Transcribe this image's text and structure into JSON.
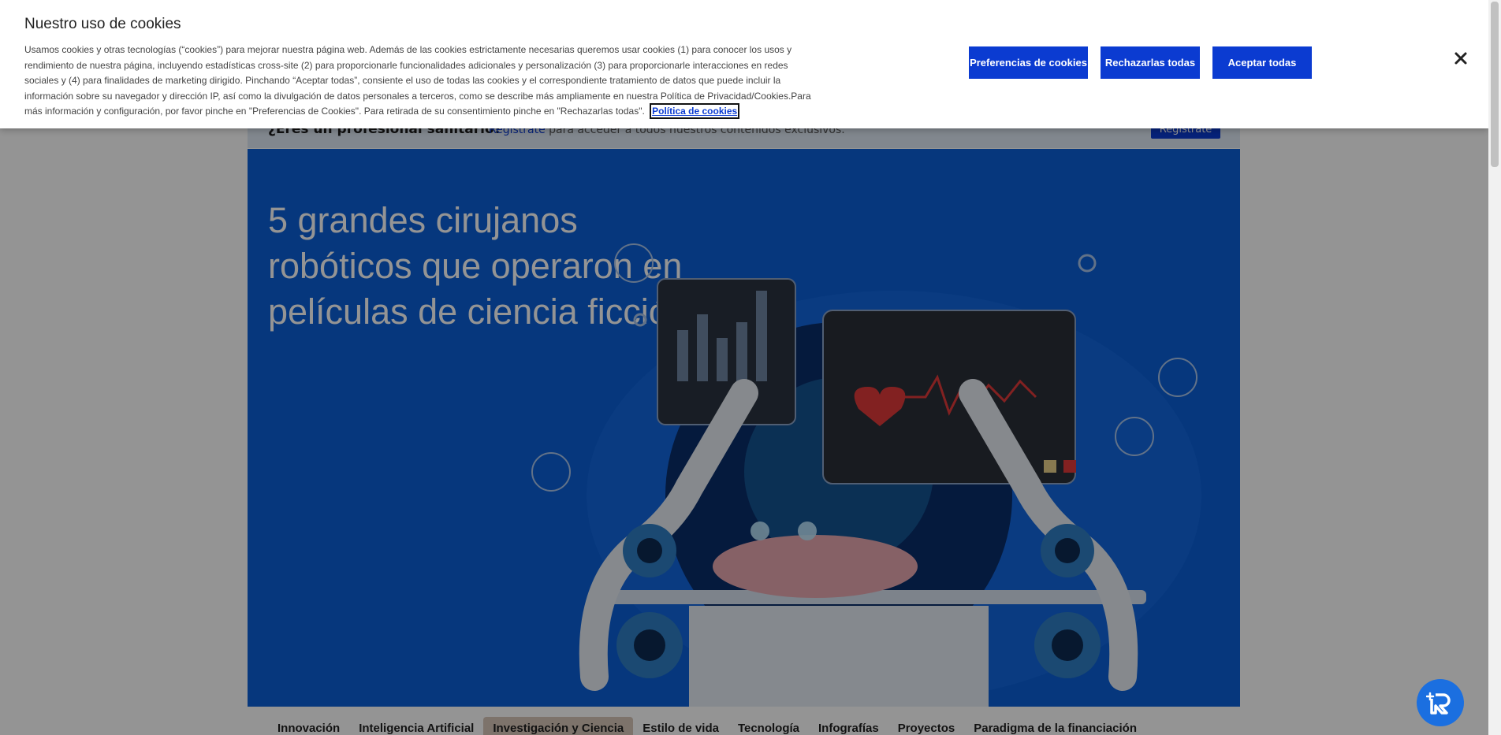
{
  "cookie_banner": {
    "title": "Nuestro uso de cookies",
    "body": "Usamos cookies y otras tecnologías (“cookies”) para mejorar nuestra página web. Además de las cookies estrictamente necesarias queremos usar cookies (1) para conocer los usos y rendimiento de nuestra página, incluyendo estadísticas cross-site (2) para proporcionarle funcionalidades adicionales y personalización (3) para proporcionarle interacciones en redes sociales y (4) para finalidades de marketing dirigido. Pinchando “Aceptar todas”, consiente el uso de todas las cookies y el correspondiente tratamiento de datos que puede incluir la información sobre su navegador y dirección IP, así como la divulgación de datos personales a terceros, como se describe más ampliamente en nuestra Política de Privacidad/Cookies.Para más información y configuración, por favor pinche en \"Preferencias de Cookies\". Para retirada de su consentimiento pinche en \"Rechazarlas todas\".",
    "policy_link": "Política de cookies",
    "buttons": {
      "preferences": "Preferencias de cookies",
      "reject_all": "Rechazarlas todas",
      "accept_all": "Aceptar todas"
    }
  },
  "register_bar": {
    "question": "¿Eres un profesional sanitario?",
    "link": "Regístrate",
    "text": "para acceder a todos nuestros contenidos exclusivos.",
    "button": "Regístrate"
  },
  "hero": {
    "title": "5 grandes cirujanos robóticos que operaron en películas de ciencia ficción"
  },
  "nav": {
    "items": [
      {
        "label": "Innovación"
      },
      {
        "label": "Inteligencia Artificial"
      },
      {
        "label": "Investigación y Ciencia",
        "active": true
      },
      {
        "label": "Estilo de vida"
      },
      {
        "label": "Tecnología"
      },
      {
        "label": "Infografías"
      },
      {
        "label": "Proyectos"
      },
      {
        "label": "Paradigma de la financiación"
      }
    ]
  },
  "colors": {
    "accent": "#0b3bd1",
    "hero_bg": "#0b5fd7"
  }
}
